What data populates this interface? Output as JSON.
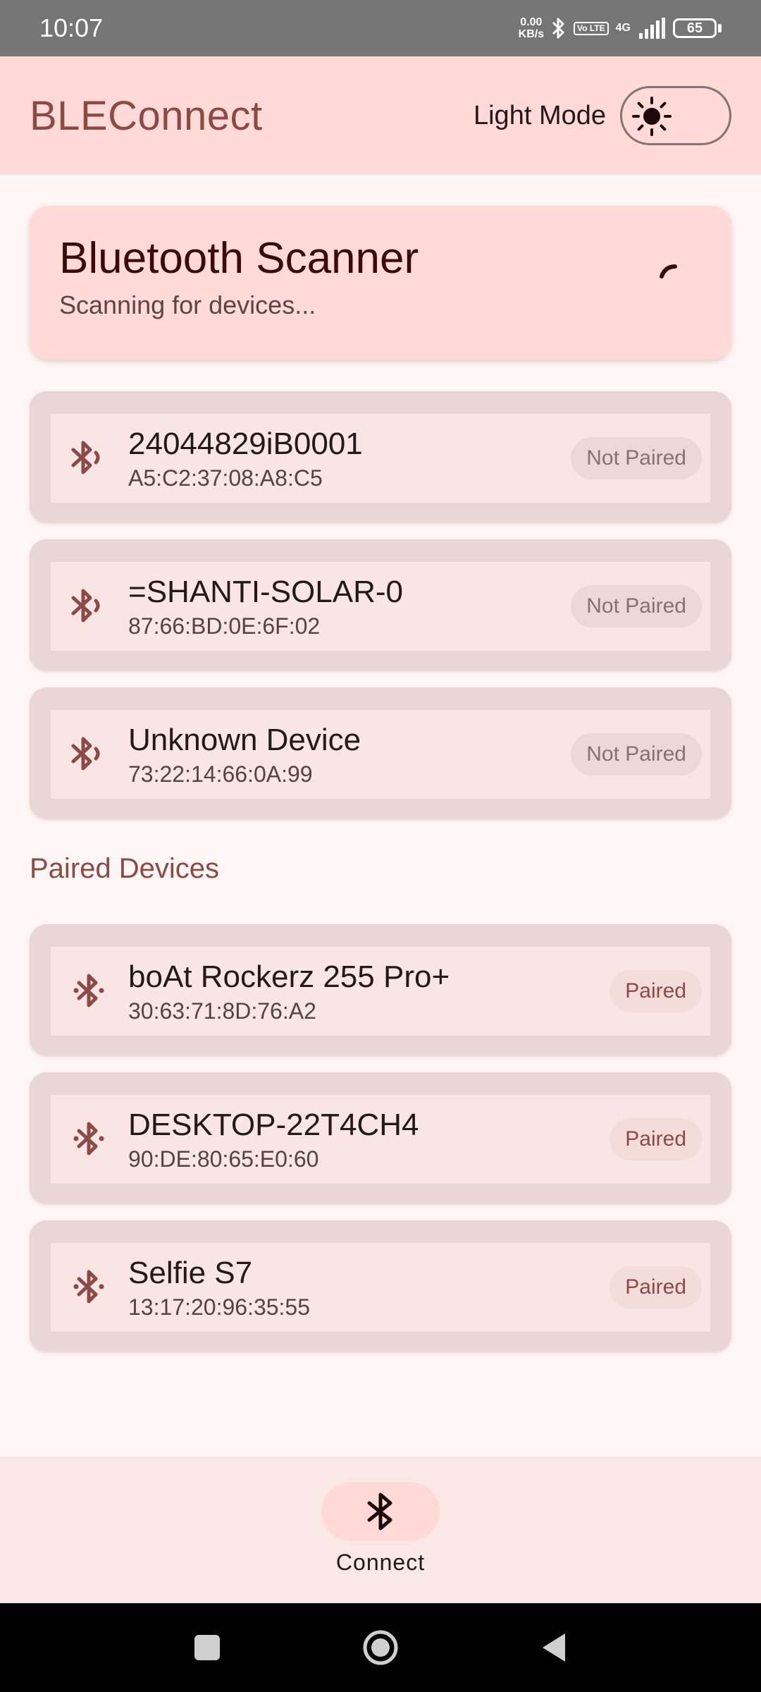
{
  "status_bar": {
    "time": "10:07",
    "speed_value": "0.00",
    "speed_unit": "KB/s",
    "volte": "Vo LTE",
    "network": "4G",
    "battery": "65"
  },
  "app_bar": {
    "title": "BLEConnect",
    "mode_label": "Light Mode"
  },
  "scanner": {
    "title": "Bluetooth Scanner",
    "status": "Scanning for devices..."
  },
  "scanned_devices": [
    {
      "name": "24044829iB0001",
      "mac": "A5:C2:37:08:A8:C5",
      "status": "Not Paired"
    },
    {
      "name": "=SHANTI-SOLAR-0",
      "mac": "87:66:BD:0E:6F:02",
      "status": "Not Paired"
    },
    {
      "name": "Unknown Device",
      "mac": "73:22:14:66:0A:99",
      "status": "Not Paired"
    }
  ],
  "paired_section": {
    "title": "Paired Devices"
  },
  "paired_devices": [
    {
      "name": "boAt Rockerz 255 Pro+",
      "mac": "30:63:71:8D:76:A2",
      "status": "Paired"
    },
    {
      "name": "DESKTOP-22T4CH4",
      "mac": "90:DE:80:65:E0:60",
      "status": "Paired"
    },
    {
      "name": "Selfie S7",
      "mac": "13:17:20:96:35:55",
      "status": "Paired"
    }
  ],
  "bottom_nav": {
    "connect_label": "Connect",
    "icon": "bluetooth-icon"
  },
  "colors": {
    "primary": "#8c4a46",
    "app_bar_bg": "#ffdad6",
    "card_bg": "#ead6d5"
  }
}
